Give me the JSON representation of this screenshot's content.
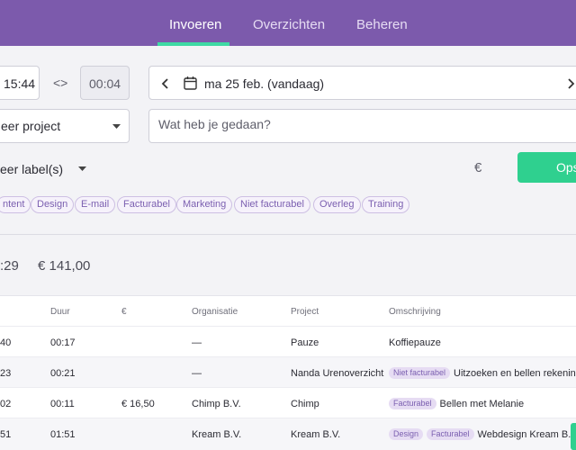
{
  "nav": {
    "tabs": [
      {
        "label": "Invoeren",
        "active": true
      },
      {
        "label": "Overzichten",
        "active": false
      },
      {
        "label": "Beheren",
        "active": false
      }
    ]
  },
  "entry": {
    "start_time": "15:44",
    "duration": "00:04",
    "swap_glyph": "<>",
    "date_label": "ma 25 feb. (vandaag)",
    "project_placeholder": "eer project",
    "description_placeholder": "Wat heb je gedaan?",
    "label_placeholder": "eer label(s)",
    "euro_symbol": "€",
    "save_label": "Opslaan"
  },
  "labels": [
    "ntent",
    "Design",
    "E-mail",
    "Facturabel",
    "Marketing",
    "Niet facturabel",
    "Overleg",
    "Training"
  ],
  "totals": {
    "time": ":29",
    "amount": "€ 141,00"
  },
  "table": {
    "headers": [
      "Duur",
      "€",
      "Organisatie",
      "Project",
      "Omschrijving"
    ],
    "rows": [
      {
        "time": "40",
        "duur": "00:17",
        "amount": "",
        "org": "—",
        "project": "Pauze",
        "tags": [],
        "desc": "Koffiepauze"
      },
      {
        "time": "23",
        "duur": "00:21",
        "amount": "",
        "org": "—",
        "project": "Nanda Urenoverzicht",
        "tags": [
          "Niet facturabel"
        ],
        "desc": "Uitzoeken en bellen rekenin..."
      },
      {
        "time": "02",
        "duur": "00:11",
        "amount": "€ 16,50",
        "org": "Chimp B.V.",
        "project": "Chimp",
        "tags": [
          "Facturabel"
        ],
        "desc": "Bellen met Melanie"
      },
      {
        "time": "51",
        "duur": "01:51",
        "amount": "",
        "org": "Kream B.V.",
        "project": "Kream B.V.",
        "tags": [
          "Design",
          "Facturabel"
        ],
        "desc": "Webdesign Kream B.V."
      }
    ]
  },
  "colors": {
    "header_bg": "#7c5aac",
    "accent_green": "#2fd08f",
    "tab_underline": "#3fd9a4",
    "label_purple": "#7b5fb0"
  }
}
